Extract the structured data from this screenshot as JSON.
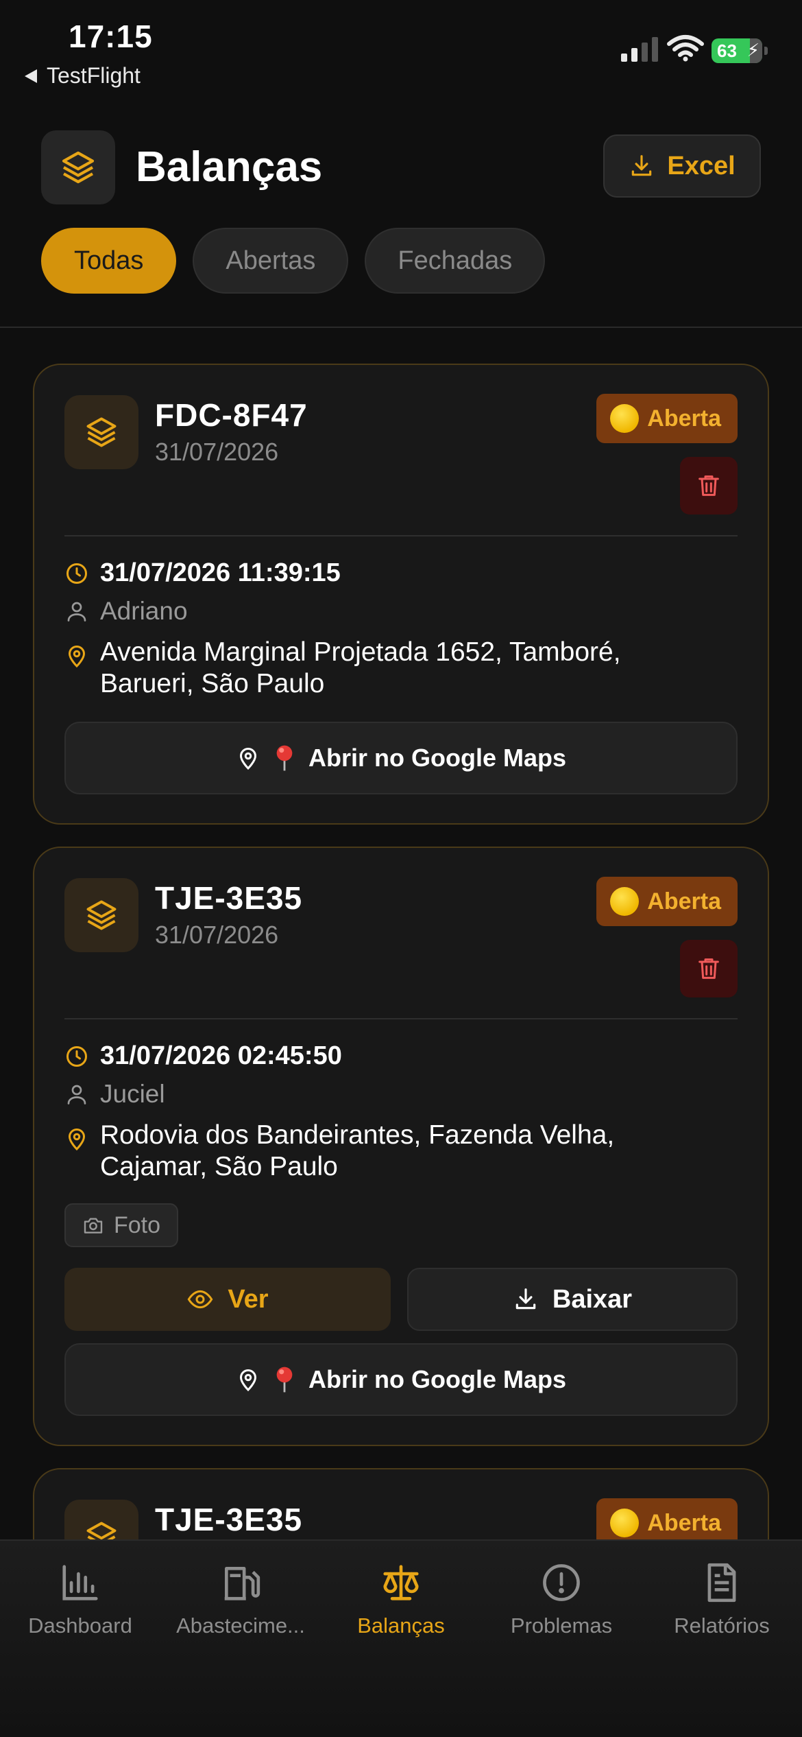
{
  "status_bar": {
    "time": "17:15",
    "back_app": "TestFlight",
    "battery": "63"
  },
  "header": {
    "icon": "layers-icon",
    "title": "Balanças",
    "excel_label": "Excel",
    "filters": [
      {
        "label": "Todas",
        "active": true
      },
      {
        "label": "Abertas",
        "active": false
      },
      {
        "label": "Fechadas",
        "active": false
      }
    ]
  },
  "cards": [
    {
      "plate": "FDC-8F47",
      "date": "31/07/2026",
      "status": "Aberta",
      "timestamp": "31/07/2026 11:39:15",
      "user": "Adriano",
      "address_line1": "Avenida Marginal Projetada 1652, Tamboré,",
      "address_line2": "Barueri, São Paulo",
      "maps_label": "Abrir no Google Maps"
    },
    {
      "plate": "TJE-3E35",
      "date": "31/07/2026",
      "status": "Aberta",
      "timestamp": "31/07/2026 02:45:50",
      "user": "Juciel",
      "address_line1": "Rodovia dos Bandeirantes, Fazenda Velha,",
      "address_line2": "Cajamar, São Paulo",
      "photo_label": "Foto",
      "view_label": "Ver",
      "download_label": "Baixar",
      "maps_label": "Abrir no Google Maps"
    },
    {
      "plate": "TJE-3E35",
      "status": "Aberta"
    }
  ],
  "tabbar": {
    "items": [
      {
        "label": "Dashboard",
        "icon": "bar-chart-icon"
      },
      {
        "label": "Abastecime...",
        "icon": "fuel-pump-icon"
      },
      {
        "label": "Balanças",
        "icon": "scale-icon",
        "active": true
      },
      {
        "label": "Problemas",
        "icon": "alert-circle-icon"
      },
      {
        "label": "Relatórios",
        "icon": "document-icon"
      }
    ]
  },
  "colors": {
    "accent": "#e8a617",
    "background": "#0f0f0f",
    "card": "#181818",
    "badge_bg": "#7a3a0f",
    "danger_bg": "#3d0e0e"
  }
}
